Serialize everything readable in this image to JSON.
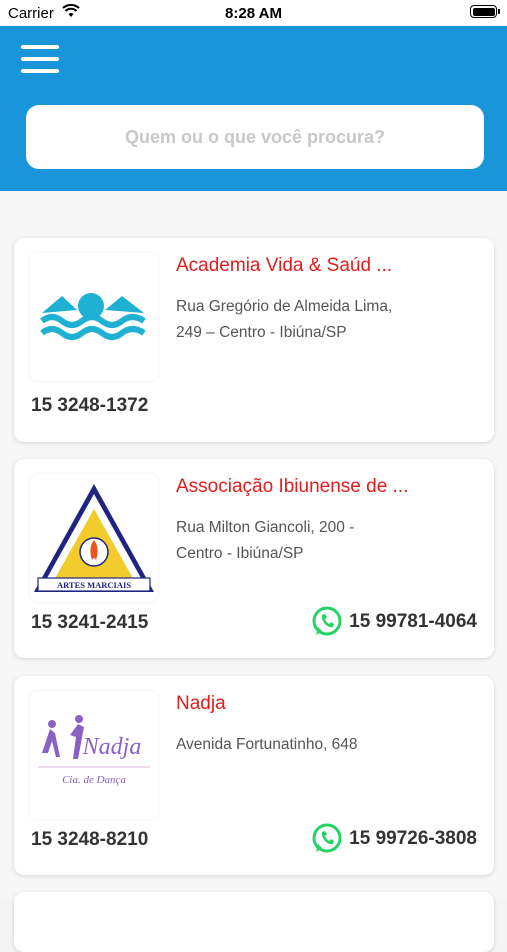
{
  "status_bar": {
    "carrier": "Carrier",
    "time": "8:28 AM"
  },
  "search": {
    "placeholder": "Quem ou o que você procura?"
  },
  "listings": [
    {
      "name": "Academia Vida & Saúd ...",
      "address": "Rua Gregório de Almeida Lima, 249 – Centro - Ibiúna/SP",
      "phone": "15 3248-1372",
      "whatsapp": ""
    },
    {
      "name": "Associação Ibiunense de ...",
      "address": "Rua Milton Giancoli, 200 - Centro - Ibiúna/SP",
      "phone": "15 3241-2415",
      "whatsapp": "15 99781-4064",
      "logo_text": "ARTES MARCIAIS"
    },
    {
      "name": "Nadja",
      "address": "Avenida Fortunatinho, 648",
      "phone": "15 3248-8210",
      "whatsapp": "15 99726-3808",
      "logo_text": "Nadja",
      "logo_subtext": "Cia. de Dança"
    }
  ],
  "colors": {
    "header": "#1b95d9",
    "name": "#e31c1c",
    "whatsapp": "#25d366"
  }
}
